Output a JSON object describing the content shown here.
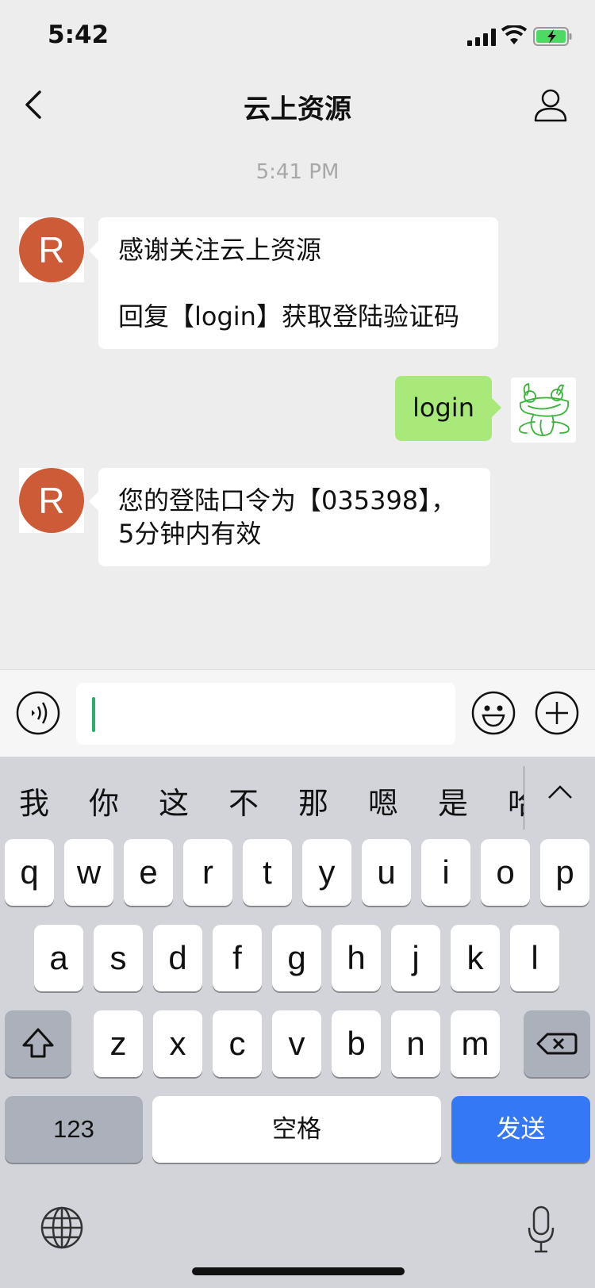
{
  "status_bar": {
    "time": "5:42"
  },
  "nav": {
    "title": "云上资源"
  },
  "chat": {
    "timestamp": "5:41 PM",
    "avatar_letter": "R",
    "messages": [
      {
        "side": "left",
        "lines": [
          "感谢关注云上资源",
          "",
          "回复【login】获取登陆验证码"
        ]
      },
      {
        "side": "right",
        "text": "login"
      },
      {
        "side": "left",
        "lines": [
          "您的登陆口令为【035398】，",
          "5分钟内有效"
        ]
      }
    ]
  },
  "keyboard": {
    "candidates": [
      "我",
      "你",
      "这",
      "不",
      "那",
      "嗯",
      "是",
      "哈"
    ],
    "row1": [
      "q",
      "w",
      "e",
      "r",
      "t",
      "y",
      "u",
      "i",
      "o",
      "p"
    ],
    "row2": [
      "a",
      "s",
      "d",
      "f",
      "g",
      "h",
      "j",
      "k",
      "l"
    ],
    "row3": [
      "z",
      "x",
      "c",
      "v",
      "b",
      "n",
      "m"
    ],
    "numbers_label": "123",
    "space_label": "空格",
    "send_label": "发送"
  },
  "colors": {
    "accent_send": "#3478f6",
    "my_bubble": "#a9e97a",
    "avatar_bg": "#cd5b38"
  }
}
